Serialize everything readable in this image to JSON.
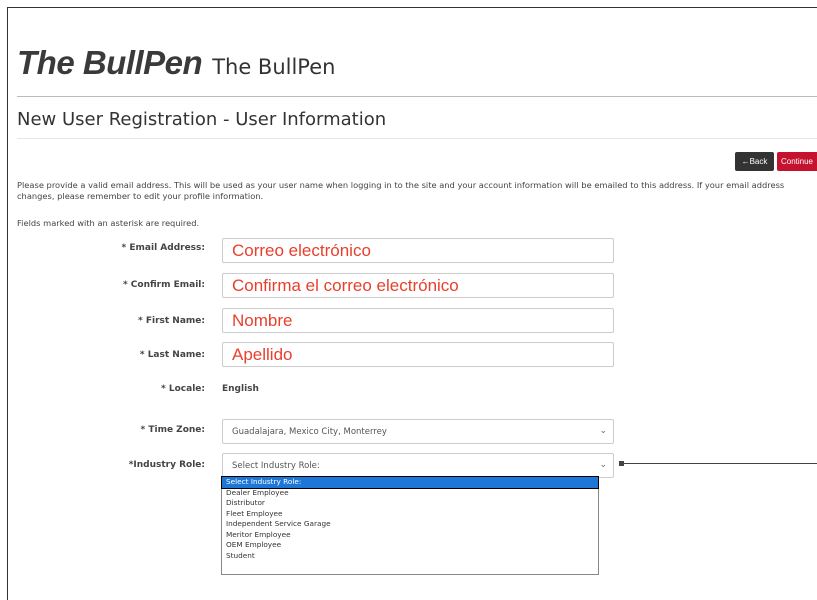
{
  "header": {
    "logo_text": "The BullPen",
    "site_name": "The BullPen"
  },
  "page": {
    "title": "New User Registration - User Information",
    "intro": "Please provide a valid email address. This will be used as your user name when logging in to the site and your account information will be emailed to this address. If your email address changes, please remember to edit your profile information.",
    "required_note": "Fields marked with an asterisk are required."
  },
  "buttons": {
    "back_label": "←Back",
    "continue_label": "Continue"
  },
  "form": {
    "email_label": "* Email Address:",
    "email_value": "Correo electrónico",
    "confirm_email_label": "* Confirm Email:",
    "confirm_email_value": "Confirma el correo electrónico",
    "first_name_label": "* First Name:",
    "first_name_value": "Nombre",
    "last_name_label": "* Last Name:",
    "last_name_value": "Apellido",
    "locale_label": "* Locale:",
    "locale_value": "English",
    "timezone_label": "* Time Zone:",
    "timezone_value": "Guadalajara, Mexico City, Monterrey",
    "industry_role_label": "*Industry Role:",
    "industry_role_value": "Select Industry Role:",
    "industry_role_options": [
      "Select Industry Role:",
      "Dealer Employee",
      "Distributor",
      "Fleet Employee",
      "Independent Service Garage",
      "Meritor Employee",
      "OEM Employee",
      "Student"
    ]
  },
  "colors": {
    "accent_red": "#c4122f",
    "annotation_red": "#e8402e",
    "highlight_blue": "#1e77d6"
  }
}
